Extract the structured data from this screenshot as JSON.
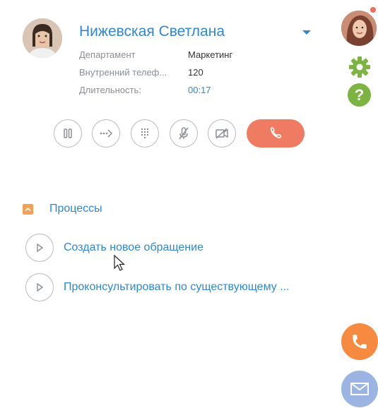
{
  "contact": {
    "name": "Нижевская Светлана",
    "rows": [
      {
        "label": "Департамент",
        "value": "Маркетинг"
      },
      {
        "label": "Внутренний телеф...",
        "value": "120"
      },
      {
        "label": "Длительность:",
        "value": "00:17"
      }
    ]
  },
  "call_controls": {
    "icons": [
      "pause-icon",
      "transfer-icon",
      "dialpad-icon",
      "mute-microphone-icon",
      "video-off-icon",
      "hang-up-icon"
    ]
  },
  "processes": {
    "title": "Процессы",
    "items": [
      {
        "label": "Создать новое обращение"
      },
      {
        "label": "Проконсультировать по существующему ..."
      }
    ]
  },
  "colors": {
    "accent_blue": "#2f87d4",
    "hangup": "#ef7b62",
    "orange": "#f58a40",
    "green": "#7cb342",
    "mail": "#9bb4e2"
  }
}
